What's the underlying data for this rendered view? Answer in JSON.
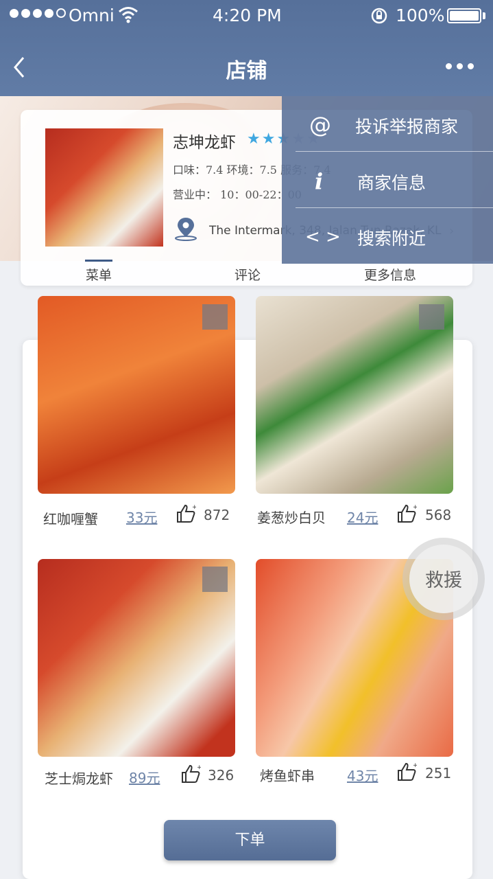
{
  "status_bar": {
    "carrier": "Omni",
    "time": "4:20 PM",
    "battery": "100%",
    "battery_level": 1.0
  },
  "nav": {
    "title": "店铺"
  },
  "shop": {
    "name": "志坤龙虾",
    "rating_stars": 3,
    "ratings_text": "口味：7.4  环境：7.5  服务：7.4",
    "hours_text": "营业中：  10：00-22：00",
    "address": "The Intermark, 348, Jalan Tun Razak, KL"
  },
  "tabs": [
    {
      "label": "菜单",
      "active": true
    },
    {
      "label": "评论",
      "active": false
    },
    {
      "label": "更多信息",
      "active": false
    }
  ],
  "menu": {
    "items": [
      {
        "icon": "@",
        "icon_name": "at-icon",
        "label": "投诉举报商家"
      },
      {
        "icon": "i",
        "icon_name": "info-icon",
        "label": "商家信息"
      },
      {
        "icon": "< >",
        "icon_name": "code-icon",
        "label": "搜索附近"
      }
    ]
  },
  "dishes": [
    {
      "name": "红咖喱蟹",
      "price": "33元",
      "likes": "872"
    },
    {
      "name": "姜葱炒白贝",
      "price": "24元",
      "likes": "568"
    },
    {
      "name": "芝士焗龙虾",
      "price": "89元",
      "likes": "326"
    },
    {
      "name": "烤鱼虾串",
      "price": "43元",
      "likes": "251"
    }
  ],
  "rescue_label": "救援",
  "order_button": "下单",
  "colors": {
    "header": "#5a74a0",
    "accent_star": "#3fa7e0",
    "price": "#6f85a8"
  }
}
